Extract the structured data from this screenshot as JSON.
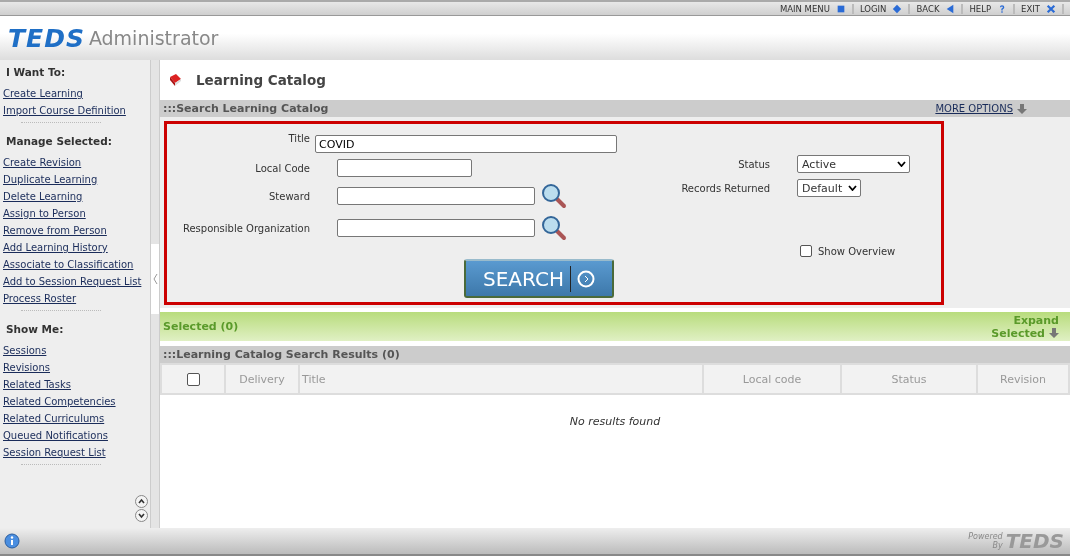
{
  "top_menu": [
    {
      "label": "MAIN MENU"
    },
    {
      "label": "LOGIN"
    },
    {
      "label": "BACK"
    },
    {
      "label": "HELP"
    },
    {
      "label": "EXIT"
    }
  ],
  "header": {
    "logo": "TEDS",
    "app_name": "Administrator"
  },
  "sidebar": {
    "sections": [
      {
        "heading": "I Want To:",
        "links": [
          "Create Learning",
          "Import Course Definition"
        ]
      },
      {
        "heading": "Manage Selected:",
        "links": [
          "Create Revision",
          "Duplicate Learning",
          "Delete Learning",
          "Assign to Person",
          "Remove from Person",
          "Add Learning History",
          "Associate to Classification",
          "Add to Session Request List",
          "Process Roster"
        ]
      },
      {
        "heading": "Show Me:",
        "links": [
          "Sessions",
          "Revisions",
          "Related Tasks",
          "Related Competencies",
          "Related Curriculums",
          "Queued Notifications",
          "Session Request List"
        ]
      }
    ]
  },
  "page_title": "Learning Catalog",
  "search_panel": {
    "heading": ":::Search Learning Catalog",
    "more_options": "MORE OPTIONS",
    "title_field": {
      "label": "Title",
      "value": "COVID"
    },
    "fields": [
      {
        "label": "Local Code",
        "lookup": false
      },
      {
        "label": "Steward",
        "lookup": true
      },
      {
        "label": "Responsible Organization",
        "lookup": true
      }
    ],
    "selects": [
      {
        "label": "Status",
        "value": "Active"
      },
      {
        "label": "Records Returned",
        "value": "Default"
      }
    ],
    "show_overview": {
      "label": "Show Overview",
      "checked": false
    },
    "search_button": "SEARCH"
  },
  "selected_bar": {
    "label": "Selected (0)",
    "expand_line1": "Expand",
    "expand_line2": "Selected"
  },
  "results": {
    "heading": ":::Learning Catalog Search Results (0)",
    "select_all_checked": false,
    "columns": [
      "Delivery",
      "Title",
      "Local code",
      "Status",
      "Revision"
    ],
    "empty_message": "No results found"
  },
  "footer": {
    "powered_line1": "Powered",
    "powered_line2": "By",
    "logo": "TEDS"
  }
}
